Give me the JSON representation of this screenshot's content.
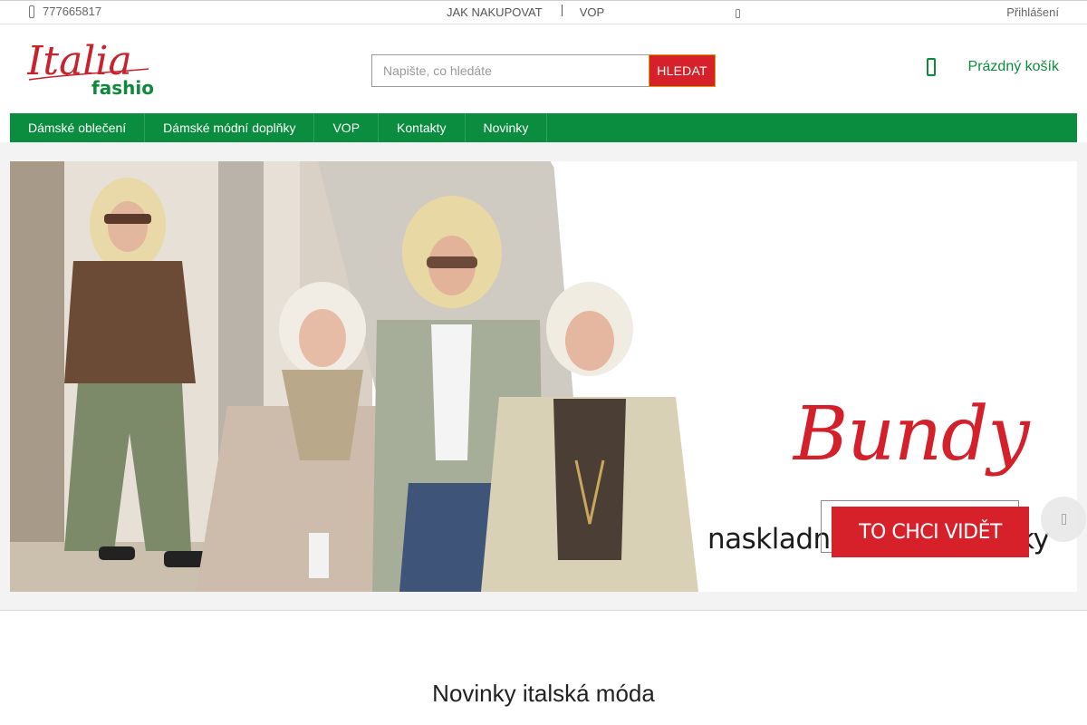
{
  "topbar": {
    "phone": "777665817",
    "links": [
      "JAK NAKUPOVAT",
      "VOP"
    ],
    "login": "Přihlášení"
  },
  "logo": {
    "script_text": "Italia",
    "word_text": "fashion"
  },
  "search": {
    "placeholder": "Napište, co hledáte",
    "button_label": "HLEDAT"
  },
  "cart": {
    "label": "Prázdný košík"
  },
  "mainnav": {
    "items": [
      "Dámské oblečení",
      "Dámské módní doplňky",
      "VOP",
      "Kontakty",
      "Novinky"
    ]
  },
  "banner": {
    "headline": "Bundy",
    "tagline": "naskladnily jsme novinky",
    "cta_label": "TO CHCI VIDĚT"
  },
  "section": {
    "title": "Novinky italská móda"
  },
  "colors": {
    "brand_green": "#0a8d3f",
    "accent_red": "#d6202a"
  },
  "icons": [
    "phone-icon",
    "more-icon",
    "cart-icon",
    "next-arrow-icon"
  ]
}
